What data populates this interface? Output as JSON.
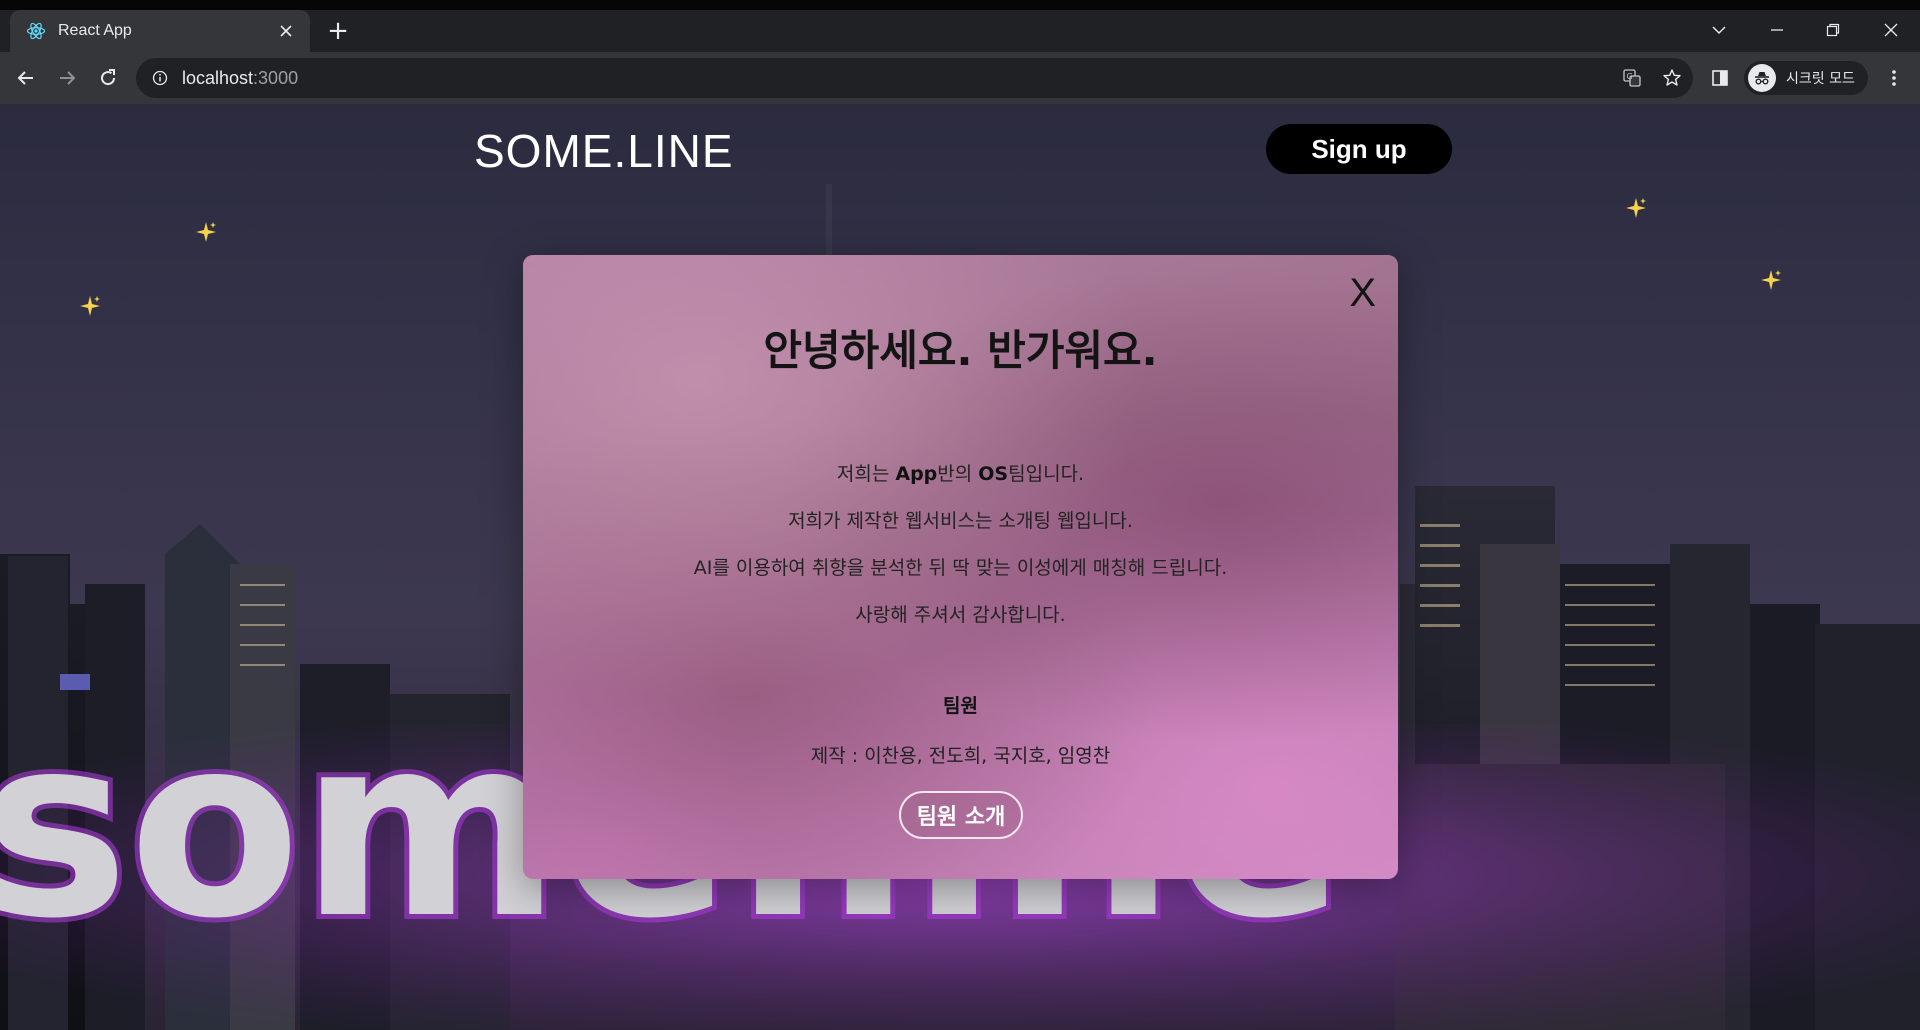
{
  "browser": {
    "tab_title": "React App",
    "new_tab_icon": "+",
    "url_host": "localhost",
    "url_port": ":3000",
    "profile_label": "시크릿 모드"
  },
  "site": {
    "logo": "SOME.LINE",
    "signup_label": "Sign up",
    "neon_sign_text": "some.line"
  },
  "modal": {
    "close_label": "X",
    "title": "안녕하세요. 반가워요.",
    "intro_lines": [
      {
        "before": "저희는 ",
        "bold1": "App",
        "middle": "반의 ",
        "bold2": "OS",
        "after": "팀입니다."
      },
      {
        "text": "저희가 제작한 웹서비스는 소개팅 웹입니다."
      },
      {
        "text": "AI를 이용하여 취향을 분석한 뒤 딱 맞는 이성에게 매칭해 드립니다."
      },
      {
        "text": "사랑해 주셔서 감사합니다."
      }
    ],
    "team_heading": "팀원",
    "team_members": "제작 : 이찬용, 전도희, 국지호, 임영찬",
    "team_button_label": "팀원 소개"
  },
  "colors": {
    "neon": "#b13de0",
    "button": "#000000",
    "modal_accent": "#c488bb"
  },
  "icons": [
    "react-icon",
    "close-icon",
    "back-icon",
    "forward-icon",
    "reload-icon",
    "info-icon",
    "translate-icon",
    "star-icon",
    "sidepanel-icon",
    "incognito-icon",
    "menu-icon",
    "sparkle-icon"
  ]
}
